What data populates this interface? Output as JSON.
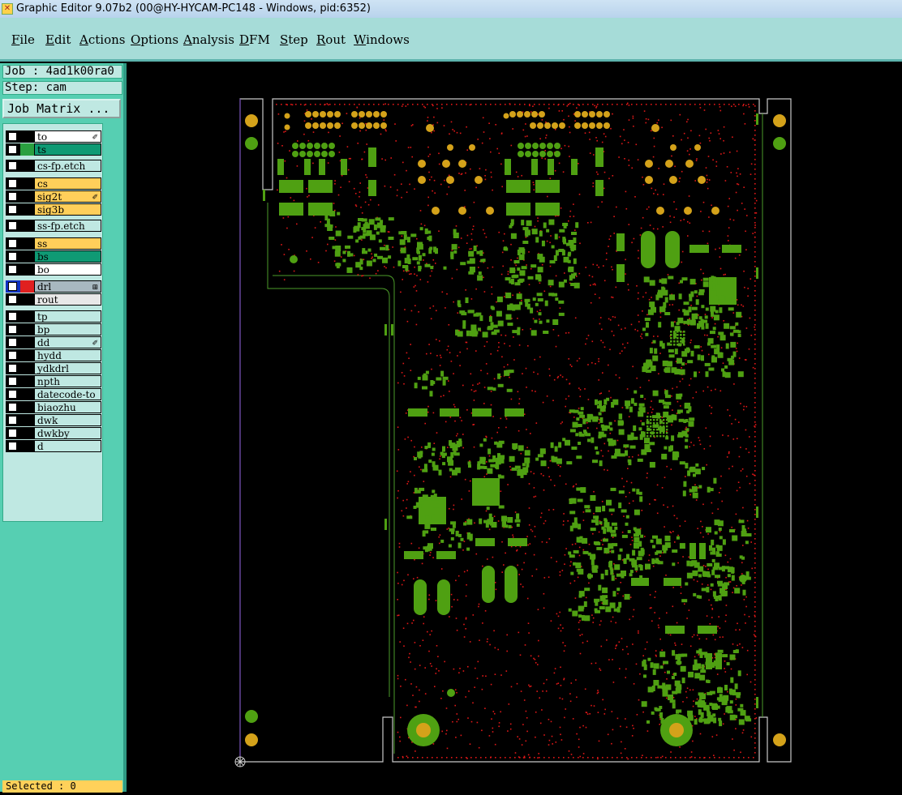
{
  "window": {
    "title": "Graphic Editor 9.07b2 (00@HY-HYCAM-PC148 - Windows, pid:6352)",
    "app_icon": "app-icon"
  },
  "menu": [
    {
      "label": "File"
    },
    {
      "label": "Edit"
    },
    {
      "label": "Actions"
    },
    {
      "label": "Options"
    },
    {
      "label": "Analysis"
    },
    {
      "label": "DFM"
    },
    {
      "label": "Step"
    },
    {
      "label": "Rout"
    },
    {
      "label": "Windows"
    }
  ],
  "job": {
    "label": "Job : 4ad1k00ra0"
  },
  "step": {
    "label": "Step: cam"
  },
  "job_matrix_label": "Job Matrix ...",
  "layers": [
    {
      "name": "to",
      "color": "#ffffff",
      "mark": "✐"
    },
    {
      "name": "ts",
      "color": "#0f9a74",
      "swatch": "#2aa040"
    },
    {
      "name": "cs-fp.etch",
      "color": "#bfe8e2"
    },
    {
      "name": "cs",
      "color": "#ffcf5a"
    },
    {
      "name": "sig2t",
      "color": "#ffcf5a",
      "mark": "✐"
    },
    {
      "name": "sig3b",
      "color": "#ffcf5a"
    },
    {
      "name": "ss-fp.etch",
      "color": "#bfe8e2"
    },
    {
      "name": "ss",
      "color": "#ffcf5a"
    },
    {
      "name": "bs",
      "color": "#0f9a74"
    },
    {
      "name": "bo",
      "color": "#ffffff"
    },
    {
      "name": "drl",
      "color": "#a8b8c0",
      "swatch": "#e02020",
      "mark": "⊞",
      "active": true
    },
    {
      "name": "rout",
      "color": "#e8e8e8"
    },
    {
      "name": "tp",
      "color": "#bfe8e2"
    },
    {
      "name": "bp",
      "color": "#bfe8e2"
    },
    {
      "name": "dd",
      "color": "#bfe8e2",
      "mark": "✐"
    },
    {
      "name": "hydd",
      "color": "#bfe8e2"
    },
    {
      "name": "ydkdrl",
      "color": "#bfe8e2"
    },
    {
      "name": "npth",
      "color": "#bfe8e2"
    },
    {
      "name": "datecode-to",
      "color": "#bfe8e2"
    },
    {
      "name": "biaozhu",
      "color": "#bfe8e2"
    },
    {
      "name": "dwk",
      "color": "#bfe8e2"
    },
    {
      "name": "dwkby",
      "color": "#bfe8e2"
    },
    {
      "name": "d",
      "color": "#bfe8e2"
    }
  ],
  "status": {
    "selected": "Selected : 0"
  },
  "colors": {
    "pad_green": "#4fa012",
    "drill_red": "#e01818",
    "gold": "#d4a21a",
    "outline": "#c8c8c8"
  }
}
